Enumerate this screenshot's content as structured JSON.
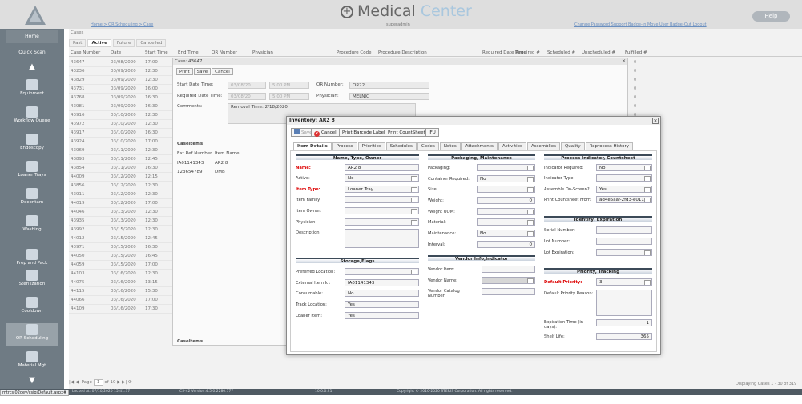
{
  "colors": {
    "sidebar": "#6f7b84",
    "header": "#dedede",
    "required": "#dd0000",
    "section_border": "#3c4a58",
    "accent": "#a9c7de"
  },
  "header": {
    "title_main": "Medical",
    "title_accent": "Center",
    "help": "Help",
    "user": "superadmin",
    "breadcrumbs": "Home > OR Scheduling > Case",
    "links": "Change Password  Support  Badge-In  Move User  Badge-Out  Logout"
  },
  "sidebar": {
    "items": [
      "Home",
      "Quick Scan",
      "Equipment",
      "Workflow Queue",
      "Endoscopy",
      "Loaner Trays",
      "Decontam",
      "Washing",
      "Prep and Pack",
      "Sterilization",
      "Cooldown",
      "OR Scheduling",
      "Material Mgt"
    ]
  },
  "list": {
    "panel_label": "Cases",
    "tabs": [
      "Past",
      "Active",
      "Future",
      "Cancelled"
    ],
    "columns": [
      "Case Number",
      "Date",
      "Start Time",
      "End Time",
      "OR Number",
      "Physician",
      "Procedure Code",
      "Procedure Description",
      "Required Date Time",
      "Required #",
      "Scheduled #",
      "Unscheduled #",
      "Fulfilled #"
    ],
    "rows": [
      [
        "43647",
        "03/08/2020",
        "17:00"
      ],
      [
        "43236",
        "03/09/2020",
        "12:30"
      ],
      [
        "43829",
        "03/09/2020",
        "12:30"
      ],
      [
        "43731",
        "03/09/2020",
        "16:00"
      ],
      [
        "43768",
        "03/09/2020",
        "16:30"
      ],
      [
        "43981",
        "03/09/2020",
        "16:30"
      ],
      [
        "43916",
        "03/10/2020",
        "12:30"
      ],
      [
        "43972",
        "03/10/2020",
        "12:30"
      ],
      [
        "43917",
        "03/10/2020",
        "16:30"
      ],
      [
        "43924",
        "03/10/2020",
        "17:00"
      ],
      [
        "43969",
        "03/11/2020",
        "12:30"
      ],
      [
        "43893",
        "03/11/2020",
        "12:45"
      ],
      [
        "43854",
        "03/11/2020",
        "16:30"
      ],
      [
        "44009",
        "03/12/2020",
        "12:15"
      ],
      [
        "43856",
        "03/12/2020",
        "12:30"
      ],
      [
        "43911",
        "03/12/2020",
        "12:30"
      ],
      [
        "44019",
        "03/12/2020",
        "17:00"
      ],
      [
        "44046",
        "03/13/2020",
        "12:30"
      ],
      [
        "43935",
        "03/13/2020",
        "12:30"
      ],
      [
        "43992",
        "03/15/2020",
        "12:30"
      ],
      [
        "44012",
        "03/15/2020",
        "12:45"
      ],
      [
        "43971",
        "03/15/2020",
        "16:30"
      ],
      [
        "44050",
        "03/15/2020",
        "16:45"
      ],
      [
        "44059",
        "03/15/2020",
        "17:00"
      ],
      [
        "44103",
        "03/16/2020",
        "12:30"
      ],
      [
        "44075",
        "03/16/2020",
        "13:15"
      ],
      [
        "44115",
        "03/16/2020",
        "15:30"
      ],
      [
        "44066",
        "03/16/2020",
        "17:00"
      ],
      [
        "44109",
        "03/16/2020",
        "17:30"
      ]
    ],
    "right_values": [
      "0",
      "0",
      "0",
      "0",
      "0",
      "0",
      "0",
      "0",
      "0",
      "0",
      "0",
      "0",
      "0",
      "0",
      "0",
      "0",
      "0",
      "0",
      "0"
    ],
    "pager": {
      "page_label": "Page",
      "page": "1",
      "of": "of 10"
    },
    "display": "Displaying Cases 1 - 30 of 319"
  },
  "case": {
    "title": "Case: 43647",
    "buttons": [
      "Print",
      "Save",
      "Cancel"
    ],
    "start_label": "Start Date Time:",
    "start_date": "03/08/20",
    "start_time": "5:00 PM",
    "req_label": "Required Date Time:",
    "req_date": "03/08/20",
    "req_time": "5:00 PM",
    "or_label": "OR Number:",
    "or_value": "OR22",
    "phys_label": "Physician:",
    "phys_value": "MELNIC",
    "comments_label": "Comments:",
    "comments_value": "Removal Time: 2/18/2020",
    "items_label": "CaseItems",
    "items_cols": [
      "Ext Ref Number",
      "Item Name"
    ],
    "items_rows": [
      [
        "IA01141343",
        "AR2 8"
      ],
      [
        "123654789",
        "DMB"
      ]
    ],
    "footer_label": "CaseItems"
  },
  "inventory": {
    "title": "Inventory: AR2 8",
    "buttons": {
      "save": "Save",
      "cancel": "Cancel",
      "print_barcode": "Print Barcode Label",
      "print_count": "Print CountSheet",
      "ifu": "IFU"
    },
    "tabs": [
      "Item Details",
      "Process",
      "Priorities",
      "Schedules",
      "Codes",
      "Notes",
      "Attachments",
      "Activities",
      "Assemblies",
      "Quality",
      "Reprocess History"
    ],
    "name_section": "Name, Type, Owner",
    "name_label": "Name:",
    "name_value": "AR2 8",
    "active_label": "Active:",
    "active_value": "No",
    "type_label": "Item Type:",
    "type_value": "Loaner Tray",
    "family_label": "Item Family:",
    "owner_label": "Item Owner:",
    "physician_label": "Physician:",
    "desc_label": "Description:",
    "storage_section": "Storage,Flags",
    "preferred_label": "Preferred Location:",
    "ext_label": "External Item Id:",
    "ext_value": "IA01141343",
    "consumable_label": "Consumable:",
    "consumable_value": "No",
    "track_label": "Track Location:",
    "track_value": "Yes",
    "loaner_label": "Loaner Item:",
    "loaner_value": "Yes",
    "pack_section": "Packaging, Maintenance",
    "packaging_label": "Packaging:",
    "container_label": "Container Required:",
    "container_value": "No",
    "size_label": "Size:",
    "weight_label": "Weight:",
    "weight_value": "0",
    "weight_uom_label": "Weight UOM:",
    "material_label": "Material:",
    "maintenance_label": "Maintenance:",
    "maintenance_value": "No",
    "interval_label": "Interval:",
    "interval_value": "0",
    "vendor_section": "Vendor Info,Indicator",
    "vendor_item_label": "Vendor Item:",
    "vendor_name_label": "Vendor Name:",
    "vendor_catalog_label": "Vendor Catalog Number:",
    "process_section": "Process Indicator, Countsheet",
    "ind_req_label": "Indicator Required:",
    "ind_req_value": "No",
    "ind_type_label": "Indicator Type:",
    "assemble_label": "Assemble On-Screen?:",
    "assemble_value": "Yes",
    "print_from_label": "Print Countsheet From:",
    "print_from_value": "ad4e5aaf-2fd3-e011-8",
    "identity_section": "Identity, Expiration",
    "serial_label": "Serial Number:",
    "lot_label": "Lot Number:",
    "lot_exp_label": "Lot Expiration:",
    "priority_section": "Priority, Tracking",
    "def_priority_label": "Default Priority:",
    "def_priority_value": "3",
    "priority_reason_label": "Default Priority Reason:",
    "exp_time_label": "Expiration Time (in days):",
    "exp_time_value": "1",
    "shelf_label": "Shelf Life:",
    "shelf_value": "365"
  },
  "footer": {
    "left": "Locked at: 07/10/2020 15:41:37",
    "mid": "CS-42 Version:4.5.0.2280.777",
    "mid2": "10.0.0.21",
    "copy": "Copyright © 2010-2020 STERIS Corporation. All rights reserved."
  },
  "url": "mtrcsi02dev/csiq/Default.aspx#"
}
